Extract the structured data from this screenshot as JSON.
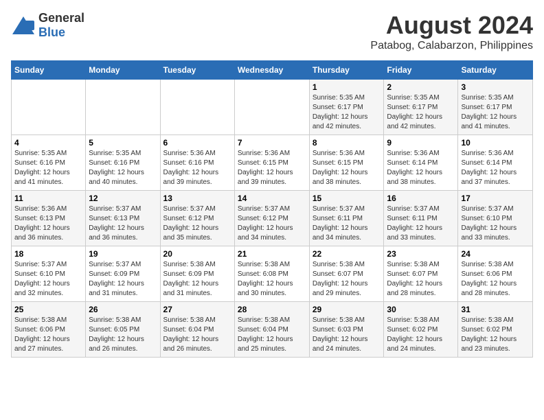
{
  "header": {
    "logo_general": "General",
    "logo_blue": "Blue",
    "title": "August 2024",
    "subtitle": "Patabog, Calabarzon, Philippines"
  },
  "calendar": {
    "days_of_week": [
      "Sunday",
      "Monday",
      "Tuesday",
      "Wednesday",
      "Thursday",
      "Friday",
      "Saturday"
    ],
    "weeks": [
      [
        {
          "day": "",
          "info": ""
        },
        {
          "day": "",
          "info": ""
        },
        {
          "day": "",
          "info": ""
        },
        {
          "day": "",
          "info": ""
        },
        {
          "day": "1",
          "info": "Sunrise: 5:35 AM\nSunset: 6:17 PM\nDaylight: 12 hours\nand 42 minutes."
        },
        {
          "day": "2",
          "info": "Sunrise: 5:35 AM\nSunset: 6:17 PM\nDaylight: 12 hours\nand 42 minutes."
        },
        {
          "day": "3",
          "info": "Sunrise: 5:35 AM\nSunset: 6:17 PM\nDaylight: 12 hours\nand 41 minutes."
        }
      ],
      [
        {
          "day": "4",
          "info": "Sunrise: 5:35 AM\nSunset: 6:16 PM\nDaylight: 12 hours\nand 41 minutes."
        },
        {
          "day": "5",
          "info": "Sunrise: 5:35 AM\nSunset: 6:16 PM\nDaylight: 12 hours\nand 40 minutes."
        },
        {
          "day": "6",
          "info": "Sunrise: 5:36 AM\nSunset: 6:16 PM\nDaylight: 12 hours\nand 39 minutes."
        },
        {
          "day": "7",
          "info": "Sunrise: 5:36 AM\nSunset: 6:15 PM\nDaylight: 12 hours\nand 39 minutes."
        },
        {
          "day": "8",
          "info": "Sunrise: 5:36 AM\nSunset: 6:15 PM\nDaylight: 12 hours\nand 38 minutes."
        },
        {
          "day": "9",
          "info": "Sunrise: 5:36 AM\nSunset: 6:14 PM\nDaylight: 12 hours\nand 38 minutes."
        },
        {
          "day": "10",
          "info": "Sunrise: 5:36 AM\nSunset: 6:14 PM\nDaylight: 12 hours\nand 37 minutes."
        }
      ],
      [
        {
          "day": "11",
          "info": "Sunrise: 5:36 AM\nSunset: 6:13 PM\nDaylight: 12 hours\nand 36 minutes."
        },
        {
          "day": "12",
          "info": "Sunrise: 5:37 AM\nSunset: 6:13 PM\nDaylight: 12 hours\nand 36 minutes."
        },
        {
          "day": "13",
          "info": "Sunrise: 5:37 AM\nSunset: 6:12 PM\nDaylight: 12 hours\nand 35 minutes."
        },
        {
          "day": "14",
          "info": "Sunrise: 5:37 AM\nSunset: 6:12 PM\nDaylight: 12 hours\nand 34 minutes."
        },
        {
          "day": "15",
          "info": "Sunrise: 5:37 AM\nSunset: 6:11 PM\nDaylight: 12 hours\nand 34 minutes."
        },
        {
          "day": "16",
          "info": "Sunrise: 5:37 AM\nSunset: 6:11 PM\nDaylight: 12 hours\nand 33 minutes."
        },
        {
          "day": "17",
          "info": "Sunrise: 5:37 AM\nSunset: 6:10 PM\nDaylight: 12 hours\nand 33 minutes."
        }
      ],
      [
        {
          "day": "18",
          "info": "Sunrise: 5:37 AM\nSunset: 6:10 PM\nDaylight: 12 hours\nand 32 minutes."
        },
        {
          "day": "19",
          "info": "Sunrise: 5:37 AM\nSunset: 6:09 PM\nDaylight: 12 hours\nand 31 minutes."
        },
        {
          "day": "20",
          "info": "Sunrise: 5:38 AM\nSunset: 6:09 PM\nDaylight: 12 hours\nand 31 minutes."
        },
        {
          "day": "21",
          "info": "Sunrise: 5:38 AM\nSunset: 6:08 PM\nDaylight: 12 hours\nand 30 minutes."
        },
        {
          "day": "22",
          "info": "Sunrise: 5:38 AM\nSunset: 6:07 PM\nDaylight: 12 hours\nand 29 minutes."
        },
        {
          "day": "23",
          "info": "Sunrise: 5:38 AM\nSunset: 6:07 PM\nDaylight: 12 hours\nand 28 minutes."
        },
        {
          "day": "24",
          "info": "Sunrise: 5:38 AM\nSunset: 6:06 PM\nDaylight: 12 hours\nand 28 minutes."
        }
      ],
      [
        {
          "day": "25",
          "info": "Sunrise: 5:38 AM\nSunset: 6:06 PM\nDaylight: 12 hours\nand 27 minutes."
        },
        {
          "day": "26",
          "info": "Sunrise: 5:38 AM\nSunset: 6:05 PM\nDaylight: 12 hours\nand 26 minutes."
        },
        {
          "day": "27",
          "info": "Sunrise: 5:38 AM\nSunset: 6:04 PM\nDaylight: 12 hours\nand 26 minutes."
        },
        {
          "day": "28",
          "info": "Sunrise: 5:38 AM\nSunset: 6:04 PM\nDaylight: 12 hours\nand 25 minutes."
        },
        {
          "day": "29",
          "info": "Sunrise: 5:38 AM\nSunset: 6:03 PM\nDaylight: 12 hours\nand 24 minutes."
        },
        {
          "day": "30",
          "info": "Sunrise: 5:38 AM\nSunset: 6:02 PM\nDaylight: 12 hours\nand 24 minutes."
        },
        {
          "day": "31",
          "info": "Sunrise: 5:38 AM\nSunset: 6:02 PM\nDaylight: 12 hours\nand 23 minutes."
        }
      ]
    ]
  }
}
